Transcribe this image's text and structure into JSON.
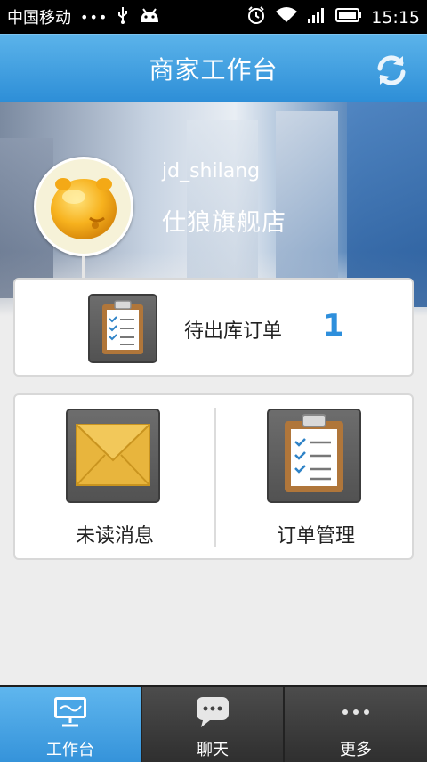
{
  "status_bar": {
    "carrier": "中国移动",
    "time": "15:15"
  },
  "header": {
    "title": "商家工作台"
  },
  "profile": {
    "username": "jd_shilang",
    "shop_name": "仕狼旗舰店"
  },
  "pending_orders": {
    "label": "待出库订单",
    "count": "1"
  },
  "menu": {
    "items": [
      {
        "label": "未读消息",
        "icon": "envelope-icon"
      },
      {
        "label": "订单管理",
        "icon": "clipboard-icon"
      }
    ]
  },
  "tabs": [
    {
      "label": "工作台",
      "icon": "monitor-icon",
      "active": true
    },
    {
      "label": "聊天",
      "icon": "chat-bubble-icon",
      "active": false
    },
    {
      "label": "更多",
      "icon": "more-dots-icon",
      "active": false
    }
  ],
  "colors": {
    "accent": "#3593da",
    "count": "#2e8fdc",
    "tab_bar": "#3a3a3a"
  }
}
